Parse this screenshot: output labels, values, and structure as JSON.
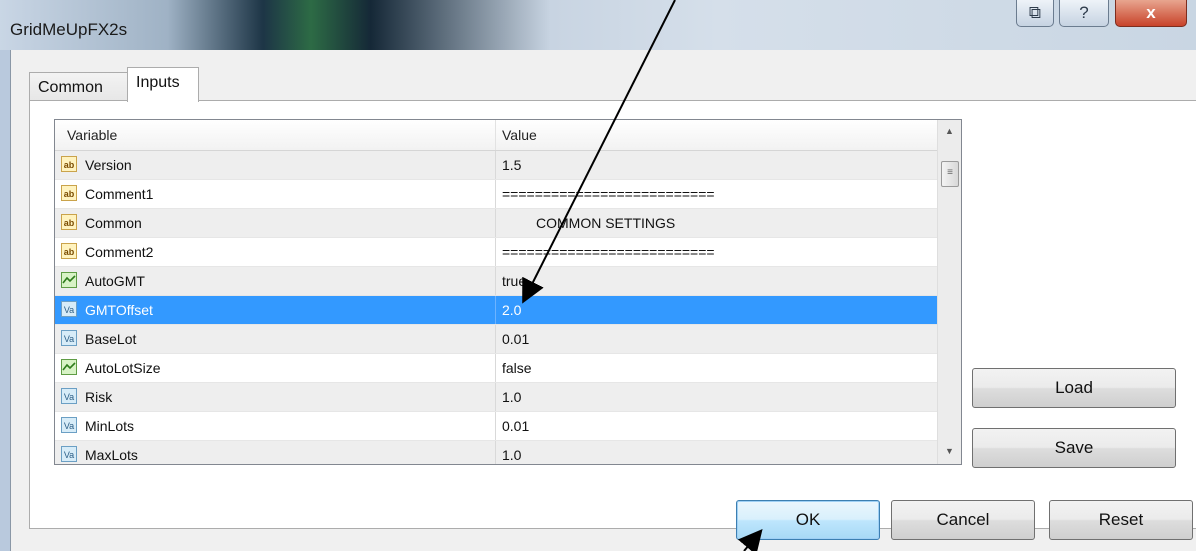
{
  "window": {
    "title": "GridMeUpFX2s",
    "controls": {
      "restore": "⧉",
      "help": "?",
      "close": "x"
    }
  },
  "tabs": [
    {
      "label": "Common",
      "active": false
    },
    {
      "label": "Inputs",
      "active": true
    }
  ],
  "grid": {
    "columns": {
      "variable": "Variable",
      "value": "Value"
    },
    "rows": [
      {
        "icon": "string-icon",
        "name": "Version",
        "value": "1.5"
      },
      {
        "icon": "string-icon",
        "name": "Comment1",
        "value": "=========================="
      },
      {
        "icon": "string-icon",
        "name": "Common",
        "value": "COMMON SETTINGS"
      },
      {
        "icon": "string-icon",
        "name": "Comment2",
        "value": "=========================="
      },
      {
        "icon": "boolean-icon",
        "name": "AutoGMT",
        "value": "true"
      },
      {
        "icon": "number-icon",
        "name": "GMTOffset",
        "value": "2.0",
        "selected": true
      },
      {
        "icon": "number-icon",
        "name": "BaseLot",
        "value": "0.01"
      },
      {
        "icon": "boolean-icon",
        "name": "AutoLotSize",
        "value": "false"
      },
      {
        "icon": "number-icon",
        "name": "Risk",
        "value": "1.0"
      },
      {
        "icon": "number-icon",
        "name": "MinLots",
        "value": "0.01"
      },
      {
        "icon": "number-icon",
        "name": "MaxLots",
        "value": "1.0"
      }
    ],
    "icon_text": {
      "string": "ab",
      "number": "Va",
      "boolean": ""
    }
  },
  "side_buttons": {
    "load": "Load",
    "save": "Save"
  },
  "footer_buttons": {
    "ok": "OK",
    "cancel": "Cancel",
    "reset": "Reset"
  },
  "colors": {
    "selection": "#3399ff",
    "annotation_arrow": "#000000"
  }
}
